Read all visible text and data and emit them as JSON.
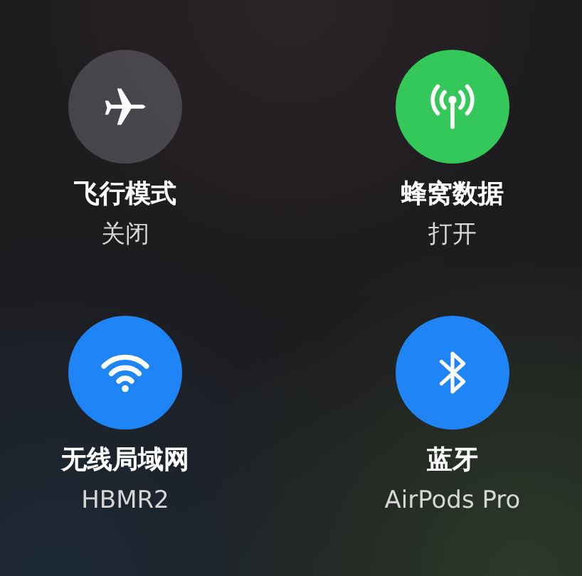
{
  "toggles": [
    {
      "kind": "airplane",
      "title": "飞行模式",
      "status": "关闭",
      "on": false
    },
    {
      "kind": "cellular",
      "title": "蜂窝数据",
      "status": "打开",
      "on": true,
      "color": "#34c759"
    },
    {
      "kind": "wifi",
      "title": "无线局域网",
      "status": "HBMR2",
      "on": true,
      "color": "#1f84f5"
    },
    {
      "kind": "bluetooth",
      "title": "蓝牙",
      "status": "AirPods Pro",
      "on": true,
      "color": "#1f84f5"
    }
  ]
}
